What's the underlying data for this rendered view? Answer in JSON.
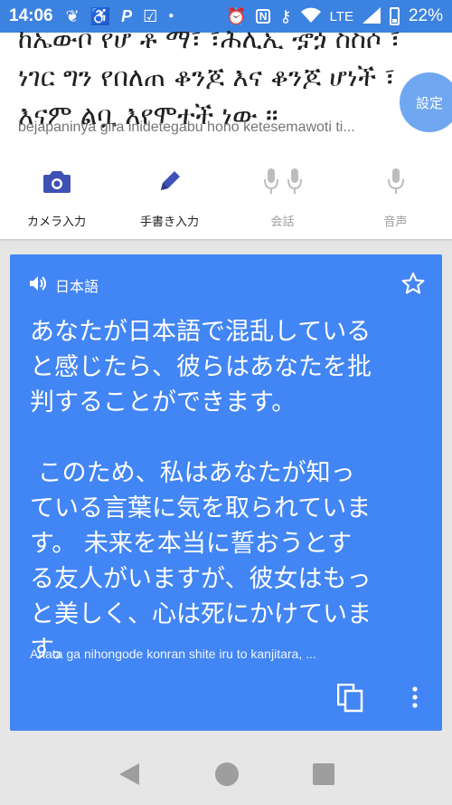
{
  "status_bar": {
    "time": "14:06",
    "network": "LTE",
    "battery": "22%"
  },
  "source": {
    "text": "ከኤውቦ የሆ ቶ ማ፣ ፣ሕሊኢ ኇጏ ስስሶ ፣\nነገር ግን የበለጠ ቆንጆ እና ቆንጆ ሆነች ፣\nእናም ልቧ እየሞተች ነው ።",
    "transliteration": "bejapaninya gira inidetegabu hono ketesemawoti ti...",
    "settings_label": "設定"
  },
  "tools": [
    {
      "label": "カメラ入力",
      "icon": "camera-icon",
      "enabled": true
    },
    {
      "label": "手書き入力",
      "icon": "pen-icon",
      "enabled": true
    },
    {
      "label": "会話",
      "icon": "conversation-mic-icon",
      "enabled": false
    },
    {
      "label": "音声",
      "icon": "mic-icon",
      "enabled": false
    }
  ],
  "translation": {
    "language": "日本語",
    "text": "あなたが日本語で混乱している\nと感じたら、彼らはあなたを批\n判することができます。\n\n このため、私はあなたが知っ\nている言葉に気を取られていま\nす。 未来を本当に誓おうとす\nる友人がいますが、彼女はもっ\nと美しく、心は死にかけていま\nす。",
    "transliteration": "Anata ga nihongode konran shite iru to kanjitara, ..."
  },
  "colors": {
    "status_bar": "#3c82e0",
    "accent": "#3f51b5",
    "card": "#4285f4",
    "disabled": "#bdbdbd"
  }
}
